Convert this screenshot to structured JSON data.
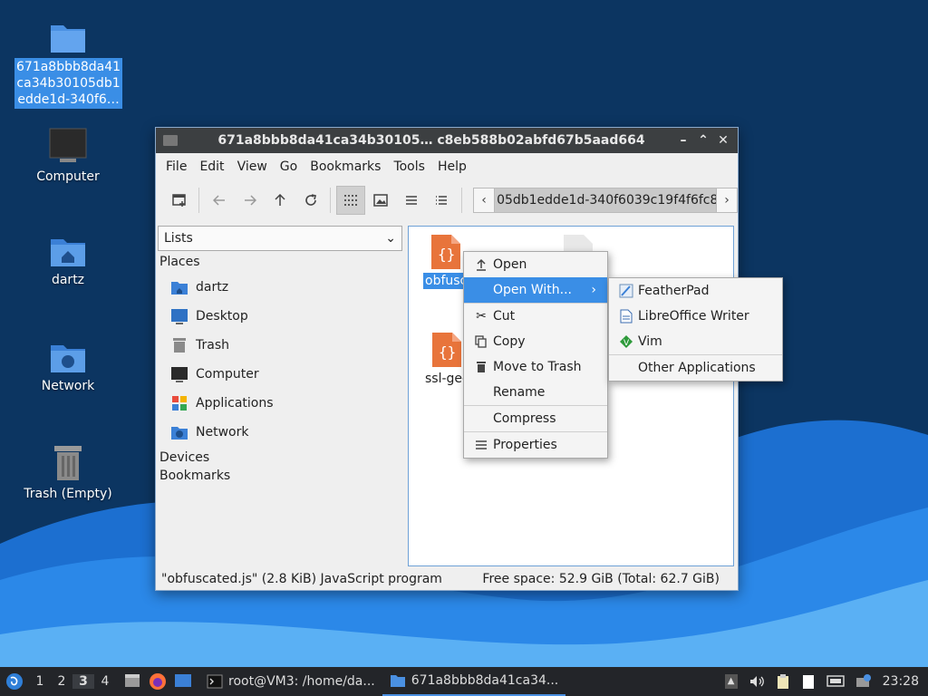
{
  "desktop": {
    "icons": [
      {
        "label": "671a8bbb8da41ca34b30105db1edde1d-340f6…",
        "icon": "folder-icon"
      },
      {
        "label": "Computer",
        "icon": "computer-icon"
      },
      {
        "label": "dartz",
        "icon": "home-folder-icon"
      },
      {
        "label": "Network",
        "icon": "network-folder-icon"
      },
      {
        "label": "Trash (Empty)",
        "icon": "trash-icon"
      }
    ],
    "selected_line1": "671a8bbb8da41",
    "selected_line2": "ca34b30105db1",
    "selected_line3": "edde1d-340f6…"
  },
  "window": {
    "title": "671a8bbb8da41ca34b30105… c8eb588b02abfd67b5aad664",
    "controls": {
      "minimize": "–",
      "maximize": "⌃",
      "close": "✕"
    }
  },
  "menubar": {
    "items": [
      "File",
      "Edit",
      "View",
      "Go",
      "Bookmarks",
      "Tools",
      "Help"
    ]
  },
  "pathbar": {
    "segment": "05db1edde1d-340f6039c19f4f6fc8e"
  },
  "sidepane": {
    "selector": "Lists",
    "places_header": "Places",
    "places": [
      {
        "label": "dartz",
        "icon": "home-folder-icon"
      },
      {
        "label": "Desktop",
        "icon": "desktop-icon"
      },
      {
        "label": "Trash",
        "icon": "trash-icon"
      },
      {
        "label": "Computer",
        "icon": "computer-icon"
      },
      {
        "label": "Applications",
        "icon": "applications-icon"
      },
      {
        "label": "Network",
        "icon": "network-icon"
      }
    ],
    "devices_header": "Devices",
    "bookmarks_header": "Bookmarks"
  },
  "files": [
    {
      "name": "obfusc",
      "selected": true,
      "icon": "javascript-file-icon"
    },
    {
      "name": "ssl-gec",
      "selected": false,
      "icon": "javascript-file-icon"
    }
  ],
  "statusbar": {
    "left": "\"obfuscated.js\" (2.8 KiB) JavaScript program",
    "right": "Free space: 52.9 GiB (Total: 62.7 GiB)"
  },
  "context_menu": {
    "items": [
      {
        "label": "Open",
        "icon": "upload-arrow-icon"
      },
      {
        "label": "Open With...",
        "icon": "",
        "highlighted": true,
        "submenu": true
      },
      {
        "label": "Cut",
        "icon": "scissors-icon"
      },
      {
        "label": "Copy",
        "icon": "copy-icon"
      },
      {
        "label": "Move to Trash",
        "icon": "trash-icon"
      },
      {
        "label": "Rename",
        "icon": ""
      },
      {
        "label": "Compress",
        "icon": ""
      },
      {
        "label": "Properties",
        "icon": "properties-icon"
      }
    ]
  },
  "submenu": {
    "items": [
      {
        "label": "FeatherPad",
        "icon": "featherpad-icon"
      },
      {
        "label": "LibreOffice Writer",
        "icon": "libreoffice-writer-icon"
      },
      {
        "label": "Vim",
        "icon": "vim-icon"
      },
      {
        "label": "Other Applications",
        "icon": ""
      }
    ]
  },
  "taskbar": {
    "workspaces": [
      "1",
      "2",
      "3",
      "4"
    ],
    "current_workspace": "3",
    "tasks": [
      {
        "label": "root@VM3: /home/da...",
        "icon": "terminal-icon"
      },
      {
        "label": "671a8bbb8da41ca34...",
        "icon": "folder-icon"
      }
    ],
    "clock": "23:28"
  },
  "colors": {
    "accent": "#3a8ee6",
    "titlebar": "#3c3f41",
    "taskbar": "#232529",
    "folder": "#4a90e2"
  }
}
